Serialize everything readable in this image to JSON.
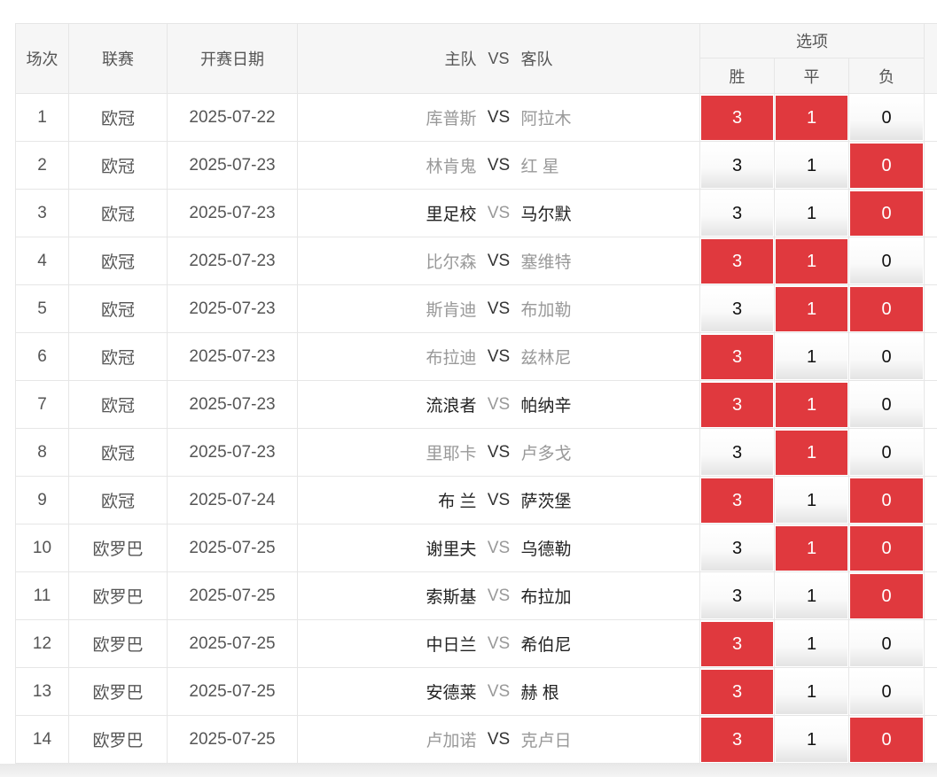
{
  "headers": {
    "session": "场次",
    "league": "联赛",
    "date": "开赛日期",
    "home": "主队",
    "vs": "VS",
    "away": "客队",
    "options": "选项",
    "win": "胜",
    "draw": "平",
    "lose": "负"
  },
  "option_values": {
    "win": "3",
    "draw": "1",
    "lose": "0"
  },
  "colors": {
    "selected": "#e0393e",
    "home_dark": "#222222",
    "muted": "#999999"
  },
  "rows": [
    {
      "no": "1",
      "league": "欧冠",
      "date": "2025-07-22",
      "home": "库普斯",
      "away": "阿拉木",
      "sel": [
        true,
        true,
        false
      ]
    },
    {
      "no": "2",
      "league": "欧冠",
      "date": "2025-07-23",
      "home": "林肯鬼",
      "away": "红 星",
      "sel": [
        false,
        false,
        true
      ]
    },
    {
      "no": "3",
      "league": "欧冠",
      "date": "2025-07-23",
      "home": "里足校",
      "away": "马尔默",
      "sel": [
        false,
        false,
        true
      ]
    },
    {
      "no": "4",
      "league": "欧冠",
      "date": "2025-07-23",
      "home": "比尔森",
      "away": "塞维特",
      "sel": [
        true,
        true,
        false
      ]
    },
    {
      "no": "5",
      "league": "欧冠",
      "date": "2025-07-23",
      "home": "斯肯迪",
      "away": "布加勒",
      "sel": [
        false,
        true,
        true
      ]
    },
    {
      "no": "6",
      "league": "欧冠",
      "date": "2025-07-23",
      "home": "布拉迪",
      "away": "兹林尼",
      "sel": [
        true,
        false,
        false
      ]
    },
    {
      "no": "7",
      "league": "欧冠",
      "date": "2025-07-23",
      "home": "流浪者",
      "away": "帕纳辛",
      "sel": [
        true,
        true,
        false
      ]
    },
    {
      "no": "8",
      "league": "欧冠",
      "date": "2025-07-23",
      "home": "里耶卡",
      "away": "卢多戈",
      "sel": [
        false,
        true,
        false
      ]
    },
    {
      "no": "9",
      "league": "欧冠",
      "date": "2025-07-24",
      "home": "布 兰",
      "away": "萨茨堡",
      "sel": [
        true,
        false,
        true
      ]
    },
    {
      "no": "10",
      "league": "欧罗巴",
      "date": "2025-07-25",
      "home": "谢里夫",
      "away": "乌德勒",
      "sel": [
        false,
        true,
        true
      ]
    },
    {
      "no": "11",
      "league": "欧罗巴",
      "date": "2025-07-25",
      "home": "索斯基",
      "away": "布拉加",
      "sel": [
        false,
        false,
        true
      ]
    },
    {
      "no": "12",
      "league": "欧罗巴",
      "date": "2025-07-25",
      "home": "中日兰",
      "away": "希伯尼",
      "sel": [
        true,
        false,
        false
      ]
    },
    {
      "no": "13",
      "league": "欧罗巴",
      "date": "2025-07-25",
      "home": "安德莱",
      "away": "赫 根",
      "sel": [
        true,
        false,
        false
      ]
    },
    {
      "no": "14",
      "league": "欧罗巴",
      "date": "2025-07-25",
      "home": "卢加诺",
      "away": "克卢日",
      "sel": [
        true,
        false,
        true
      ]
    }
  ]
}
